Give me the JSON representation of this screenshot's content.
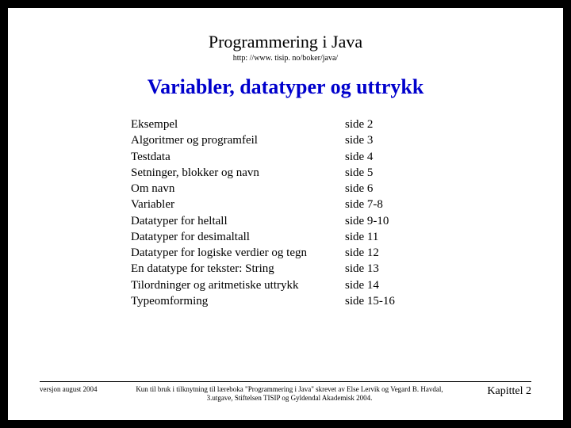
{
  "header": {
    "title": "Programmering i Java",
    "url": "http: //www. tisip. no/boker/java/"
  },
  "heading": "Variabler, datatyper og uttrykk",
  "toc": [
    {
      "label": "Eksempel",
      "page": "side 2"
    },
    {
      "label": "Algoritmer og programfeil",
      "page": "side 3"
    },
    {
      "label": "Testdata",
      "page": "side 4"
    },
    {
      "label": "Setninger, blokker og navn",
      "page": "side 5"
    },
    {
      "label": "Om navn",
      "page": "side 6"
    },
    {
      "label": "Variabler",
      "page": "side 7-8"
    },
    {
      "label": "Datatyper for heltall",
      "page": "side 9-10"
    },
    {
      "label": "Datatyper for desimaltall",
      "page": "side 11"
    },
    {
      "label": "Datatyper for logiske verdier og tegn",
      "page": "side 12"
    },
    {
      "label": "En datatype for tekster: String",
      "page": "side 13"
    },
    {
      "label": "Tilordninger og aritmetiske uttrykk",
      "page": "side 14"
    },
    {
      "label": "Typeomforming",
      "page": "side 15-16"
    }
  ],
  "footer": {
    "left": "versjon august 2004",
    "center": "Kun til bruk i tilknytning til læreboka \"Programmering i Java\" skrevet av Else Lervik og Vegard B. Havdal, 3.utgave, Stiftelsen TISIP og Gyldendal Akademisk 2004.",
    "right": "Kapittel 2"
  }
}
